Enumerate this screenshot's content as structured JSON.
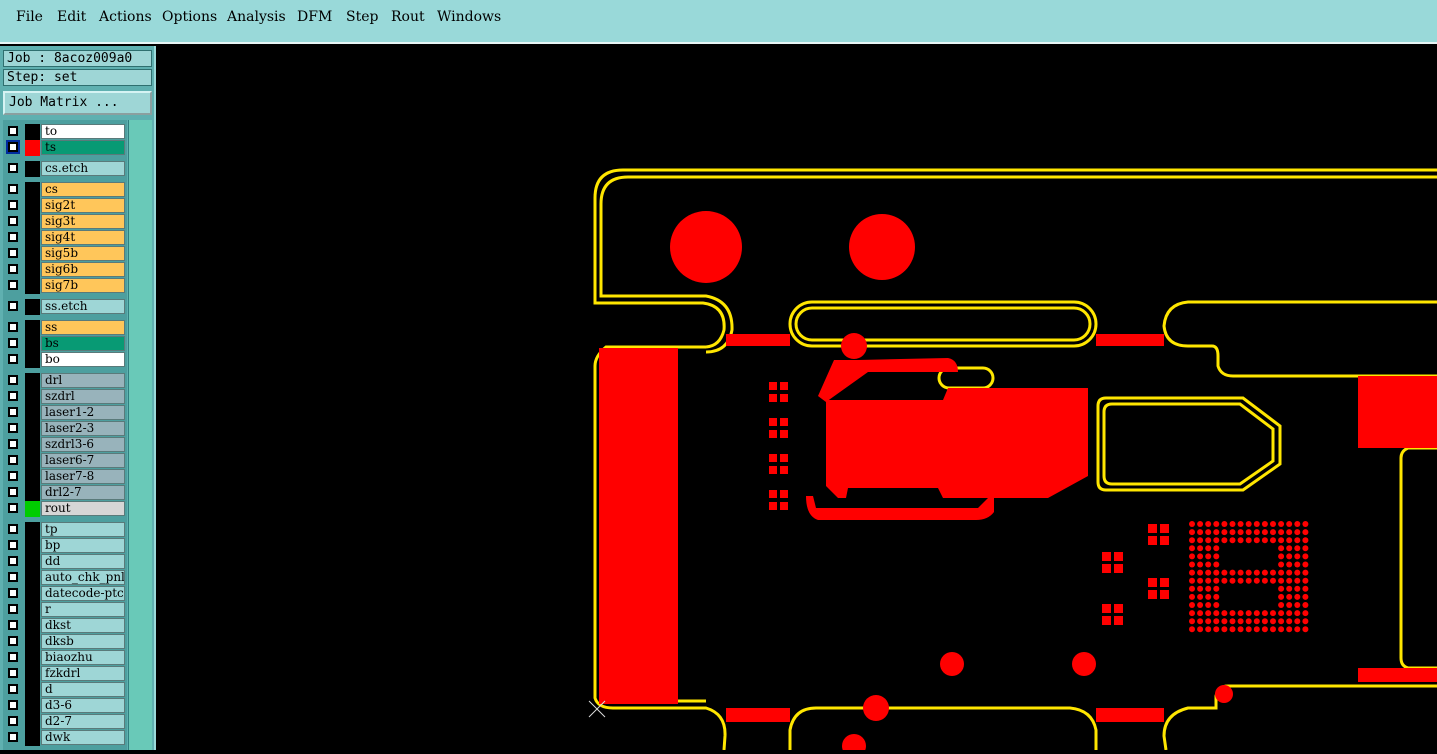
{
  "menu": [
    {
      "label": "File"
    },
    {
      "label": "Edit"
    },
    {
      "label": "Actions"
    },
    {
      "label": "Options"
    },
    {
      "label": "Analysis"
    },
    {
      "label": "DFM"
    },
    {
      "label": "Step"
    },
    {
      "label": "Rout"
    },
    {
      "label": "Windows"
    }
  ],
  "job": {
    "label": "Job : 8acoz009a0"
  },
  "step": {
    "label": "Step: set"
  },
  "job_matrix": {
    "label": "Job Matrix ..."
  },
  "colors": {
    "white_layer": "#ffffff",
    "signal_layer": "#ffc65a",
    "etch_layer": "#9ed6d6",
    "drill_layer": "#98b3bb",
    "green_layer": "#089a74",
    "rout_layer": "#d6d6d6",
    "board_red": "#ff0000",
    "outline_yellow": "#ffe600"
  },
  "layers": [
    {
      "name": "to",
      "color": "#ffffff",
      "group": 0
    },
    {
      "name": "ts",
      "color": "#089a74",
      "group": 0,
      "selected": true,
      "swatch": "#ff0000"
    },
    {
      "name": "cs.etch",
      "color": "#9ed6d6",
      "group": 1
    },
    {
      "name": "cs",
      "color": "#ffc65a",
      "group": 2
    },
    {
      "name": "sig2t",
      "color": "#ffc65a",
      "group": 2
    },
    {
      "name": "sig3t",
      "color": "#ffc65a",
      "group": 2
    },
    {
      "name": "sig4t",
      "color": "#ffc65a",
      "group": 2
    },
    {
      "name": "sig5b",
      "color": "#ffc65a",
      "group": 2
    },
    {
      "name": "sig6b",
      "color": "#ffc65a",
      "group": 2
    },
    {
      "name": "sig7b",
      "color": "#ffc65a",
      "group": 2
    },
    {
      "name": "ss.etch",
      "color": "#9ed6d6",
      "group": 3
    },
    {
      "name": "ss",
      "color": "#ffc65a",
      "group": 4
    },
    {
      "name": "bs",
      "color": "#089a74",
      "group": 4
    },
    {
      "name": "bo",
      "color": "#ffffff",
      "group": 4
    },
    {
      "name": "drl",
      "color": "#98b3bb",
      "group": 5
    },
    {
      "name": "szdrl",
      "color": "#98b3bb",
      "group": 5
    },
    {
      "name": "laser1-2",
      "color": "#98b3bb",
      "group": 5
    },
    {
      "name": "laser2-3",
      "color": "#98b3bb",
      "group": 5
    },
    {
      "name": "szdrl3-6",
      "color": "#98b3bb",
      "group": 5
    },
    {
      "name": "laser6-7",
      "color": "#98b3bb",
      "group": 5
    },
    {
      "name": "laser7-8",
      "color": "#98b3bb",
      "group": 5
    },
    {
      "name": "drl2-7",
      "color": "#98b3bb",
      "group": 5
    },
    {
      "name": "rout",
      "color": "#d6d6d6",
      "group": 5,
      "swatch": "#00cc00"
    },
    {
      "name": "tp",
      "color": "#9ed6d6",
      "group": 6
    },
    {
      "name": "bp",
      "color": "#9ed6d6",
      "group": 6
    },
    {
      "name": "dd",
      "color": "#9ed6d6",
      "group": 6
    },
    {
      "name": "auto_chk_pnl",
      "color": "#9ed6d6",
      "group": 6
    },
    {
      "name": "datecode-ptc",
      "color": "#9ed6d6",
      "group": 6
    },
    {
      "name": "r",
      "color": "#9ed6d6",
      "group": 6
    },
    {
      "name": "dkst",
      "color": "#9ed6d6",
      "group": 6
    },
    {
      "name": "dksb",
      "color": "#9ed6d6",
      "group": 6
    },
    {
      "name": "biaozhu",
      "color": "#9ed6d6",
      "group": 6
    },
    {
      "name": "fzkdrl",
      "color": "#9ed6d6",
      "group": 6
    },
    {
      "name": "d",
      "color": "#9ed6d6",
      "group": 6
    },
    {
      "name": "d3-6",
      "color": "#9ed6d6",
      "group": 6
    },
    {
      "name": "d2-7",
      "color": "#9ed6d6",
      "group": 6
    },
    {
      "name": "dwk",
      "color": "#9ed6d6",
      "group": 6
    }
  ]
}
